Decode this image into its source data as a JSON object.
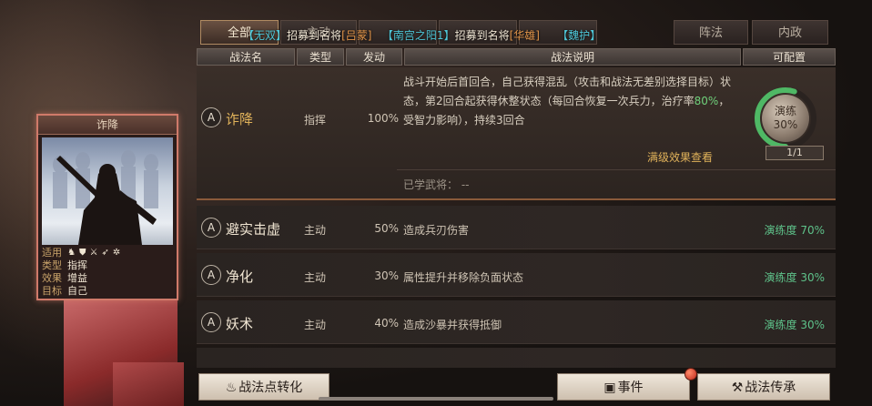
{
  "tabs": [
    {
      "label": "全部",
      "active": true
    },
    {
      "label": "主动",
      "active": false
    },
    {
      "label": "",
      "active": false
    },
    {
      "label": "",
      "active": false
    },
    {
      "label": "",
      "active": false
    },
    {
      "label": "阵法",
      "active": false
    },
    {
      "label": "内政",
      "active": false
    }
  ],
  "ticker": {
    "a_name": "无双",
    "a_text": "招募到名将",
    "a_general": "吕蒙",
    "b_name": "南宫之阳1",
    "b_text": "招募到名将",
    "b_general": "华雄",
    "c_name": "魏护"
  },
  "table_header": {
    "name": "战法名",
    "type": "类型",
    "rate": "发动",
    "desc": "战法说明",
    "config": "可配置"
  },
  "card": {
    "title": "诈降",
    "labels": {
      "use": "适用",
      "type": "类型",
      "effect": "效果",
      "target": "目标"
    },
    "type": "指挥",
    "effect": "增益",
    "target": "自己",
    "unit_icons": [
      "horse-icon",
      "shield-icon",
      "crossed-swords-icon",
      "bow-icon",
      "wheel-icon"
    ]
  },
  "skills": [
    {
      "grade": "A",
      "name": "诈降",
      "type": "指挥",
      "rate": "100%",
      "desc_parts": [
        "战斗开始后首回合，自己获得混乱（攻击和战法无差别选择目标）状态，第2回合起获得休整状态（每回合恢复一次兵力，治疗率",
        "80%",
        "，受智力影响），持续3回合"
      ],
      "learned_label": "已学武将：",
      "learned_value": "--",
      "view_full": "满级效果查看",
      "drill_label": "演练",
      "drill_percent": "30%",
      "drill_progress": 0.3,
      "slots": "1/1"
    },
    {
      "grade": "A",
      "name": "避实击虚",
      "type": "主动",
      "rate": "50%",
      "desc": "造成兵刃伤害",
      "proficiency": "演练度 70%"
    },
    {
      "grade": "A",
      "name": "净化",
      "type": "主动",
      "rate": "30%",
      "desc": "属性提升并移除负面状态",
      "proficiency": "演练度 30%"
    },
    {
      "grade": "A",
      "name": "妖术",
      "type": "主动",
      "rate": "40%",
      "desc": "造成沙暴并获得抵御",
      "proficiency": "演练度 30%"
    }
  ],
  "buttons": {
    "convert": "战法点转化",
    "events": "事件",
    "inherit": "战法传承"
  },
  "colors": {
    "accent": "#b08a62",
    "green": "#5ec28a",
    "card_border": "#d07a6a"
  }
}
